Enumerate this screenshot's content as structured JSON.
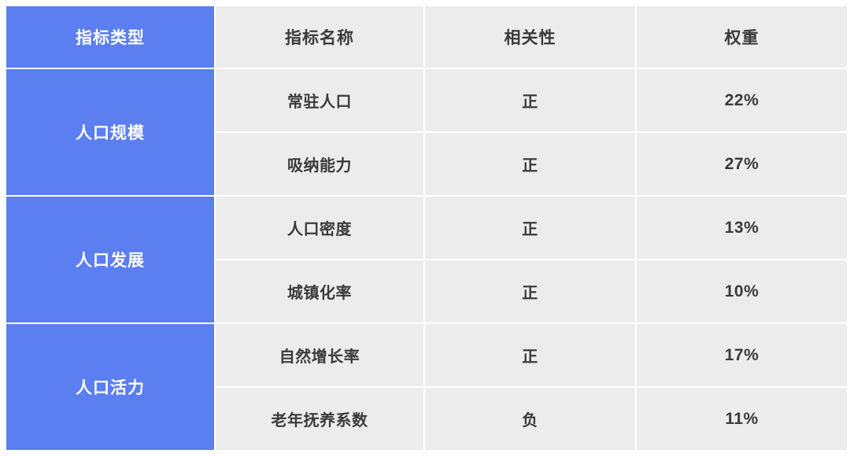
{
  "table": {
    "columns": [
      {
        "key": "category",
        "label": "指标类型",
        "style": "accent"
      },
      {
        "key": "indicator",
        "label": "指标名称",
        "style": "plain"
      },
      {
        "key": "relation",
        "label": "相关性",
        "style": "plain"
      },
      {
        "key": "weight",
        "label": "权重",
        "style": "plain"
      }
    ],
    "groups": [
      {
        "category": "人口规模",
        "rows": [
          {
            "indicator": "常驻人口",
            "relation": "正",
            "weight": "22%"
          },
          {
            "indicator": "吸纳能力",
            "relation": "正",
            "weight": "27%"
          }
        ]
      },
      {
        "category": "人口发展",
        "rows": [
          {
            "indicator": "人口密度",
            "relation": "正",
            "weight": "13%"
          },
          {
            "indicator": "城镇化率",
            "relation": "正",
            "weight": "10%"
          }
        ]
      },
      {
        "category": "人口活力",
        "rows": [
          {
            "indicator": "自然增长率",
            "relation": "正",
            "weight": "17%"
          },
          {
            "indicator": "老年抚养系数",
            "relation": "负",
            "weight": "11%"
          }
        ]
      }
    ]
  },
  "colors": {
    "accent": "#5B7EF0",
    "cell_background": "#ECECEC",
    "page_background": "#FFFFFF",
    "text": "#3A3A3A",
    "accent_text": "#FFFFFF"
  }
}
